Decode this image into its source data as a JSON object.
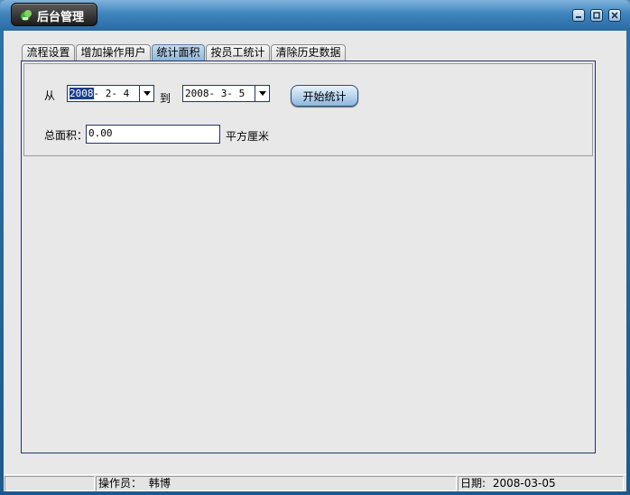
{
  "window": {
    "title": "后台管理"
  },
  "tabs": [
    {
      "label": "流程设置"
    },
    {
      "label": "增加操作用户"
    },
    {
      "label": "统计面积"
    },
    {
      "label": "按员工统计"
    },
    {
      "label": "清除历史数据"
    }
  ],
  "active_tab": "统计面积",
  "stats": {
    "from_label": "从",
    "to_label": "到",
    "from_date_selected": "2008",
    "from_date_rest": "- 2- 4",
    "to_date": "2008- 3- 5",
    "start_button": "开始统计",
    "total_label": "总面积：",
    "total_value": "0.00",
    "unit": "平方厘米"
  },
  "statusbar": {
    "cell1": "",
    "operator_label": "操作员：",
    "operator_name": "韩博",
    "date_label": "日期:",
    "date_value": "2008-03-05"
  },
  "colors": {
    "titlebar": "#3f84bd",
    "border_dark": "#23336b",
    "active_tab": "#8fb6d9"
  }
}
